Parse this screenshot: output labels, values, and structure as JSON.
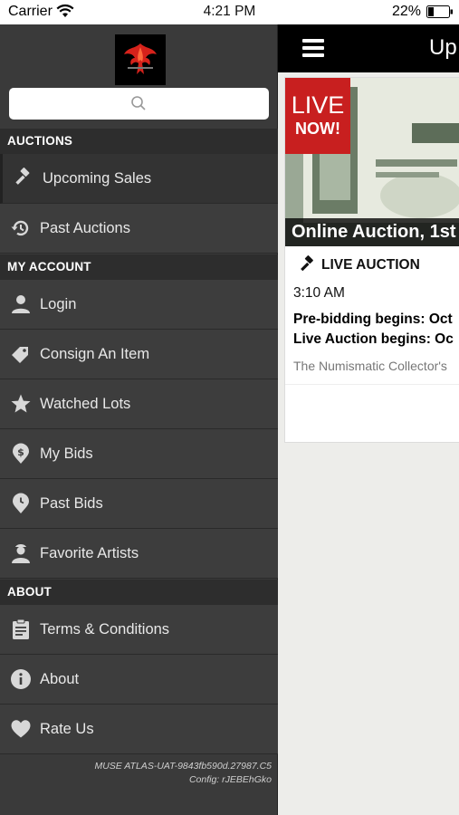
{
  "status_bar": {
    "carrier": "Carrier",
    "time": "4:21 PM",
    "battery": "22%"
  },
  "drawer": {
    "search_placeholder": "",
    "sections": {
      "auctions": "AUCTIONS",
      "my_account": "MY ACCOUNT",
      "about": "ABOUT"
    },
    "items": [
      {
        "label": "Upcoming Sales",
        "icon": "gavel-icon"
      },
      {
        "label": "Past Auctions",
        "icon": "history-icon"
      },
      {
        "label": "Login",
        "icon": "person-icon"
      },
      {
        "label": "Consign An Item",
        "icon": "tag-icon"
      },
      {
        "label": "Watched Lots",
        "icon": "star-icon"
      },
      {
        "label": "My Bids",
        "icon": "dollar-pin-icon"
      },
      {
        "label": "Past Bids",
        "icon": "clock-pin-icon"
      },
      {
        "label": "Favorite Artists",
        "icon": "artist-icon"
      },
      {
        "label": "Terms & Conditions",
        "icon": "clipboard-icon"
      },
      {
        "label": "About",
        "icon": "info-icon"
      },
      {
        "label": "Rate Us",
        "icon": "heart-icon"
      }
    ],
    "footer": {
      "build": "MUSE ATLAS-UAT-9843fb590d.27987.C5",
      "config": "Config: rJEBEhGko"
    }
  },
  "main": {
    "title": "Up",
    "card": {
      "badge_line1": "LIVE",
      "badge_line2": "NOW!",
      "banner_title": "Online Auction, 1st",
      "live_label": "LIVE AUCTION",
      "time": "3:10 AM",
      "line1": "Pre-bidding begins: Oct",
      "line2": "Live Auction begins: Oc",
      "description": "The Numismatic Collector's"
    }
  },
  "colors": {
    "drawer_bg": "#3a3a3a",
    "section_bg": "#2d2d2d",
    "live_red": "#c81f1f",
    "navbar": "#000000"
  }
}
